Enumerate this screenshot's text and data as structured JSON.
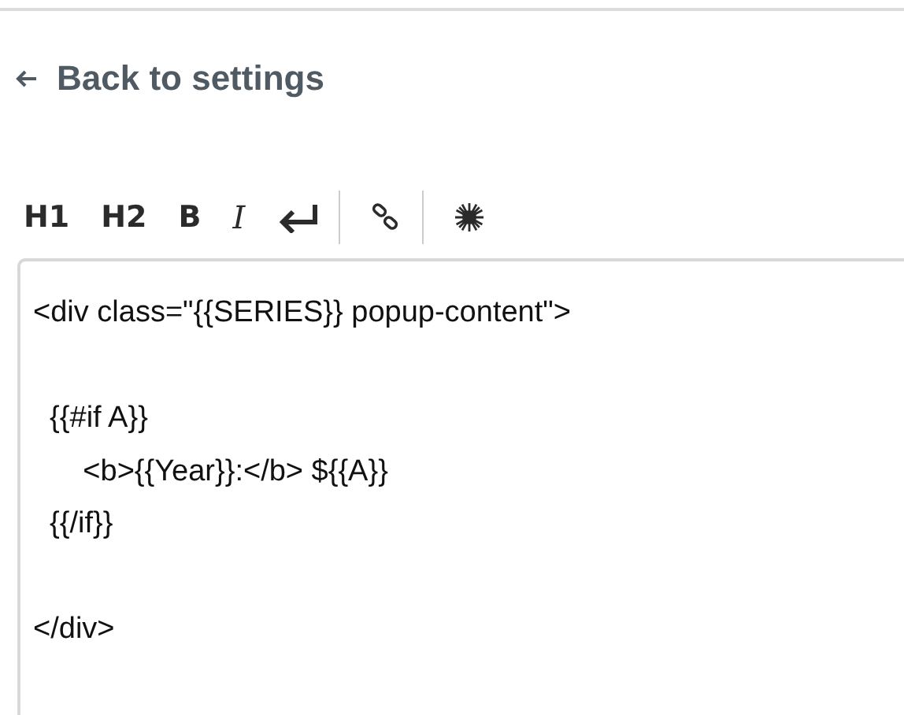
{
  "back_link": {
    "label": "Back to settings"
  },
  "toolbar": {
    "groups": [
      [
        {
          "kind": "heading",
          "label": "H1"
        },
        {
          "kind": "heading",
          "label": "H2"
        },
        {
          "kind": "bold",
          "label": "B"
        },
        {
          "kind": "italic",
          "label": "I"
        },
        {
          "kind": "enter"
        }
      ],
      [
        {
          "kind": "link"
        }
      ],
      [
        {
          "kind": "burst"
        }
      ]
    ]
  },
  "editor": {
    "value": "<div class=\"{{SERIES}} popup-content\">\n\n  {{#if A}}\n      <b>{{Year}}:</b> ${{A}}\n  {{/if}}\n\n</div>"
  }
}
